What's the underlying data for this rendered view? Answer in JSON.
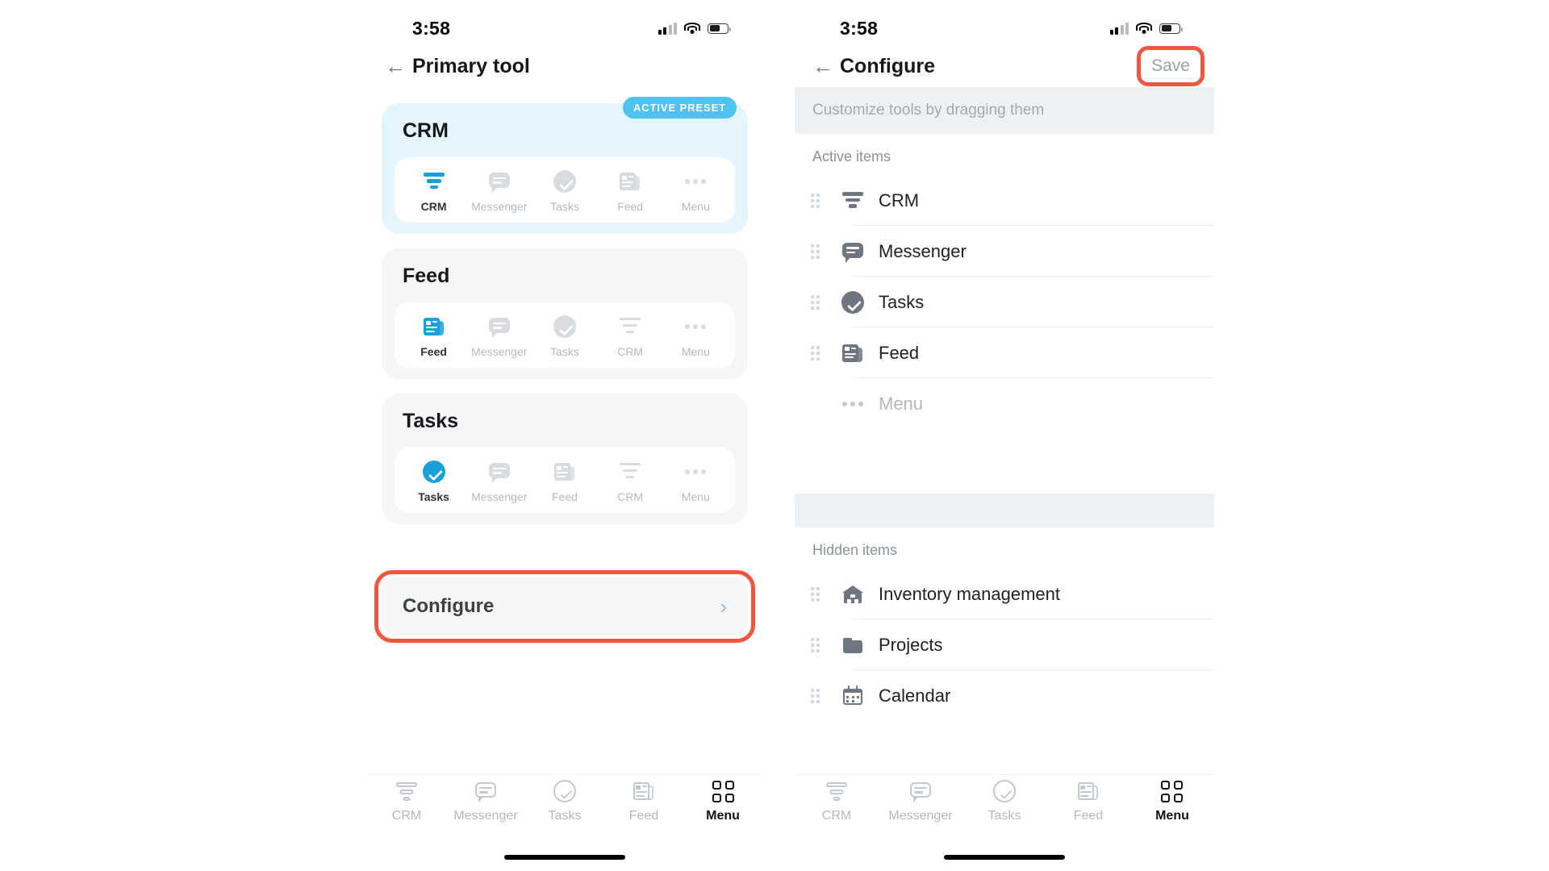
{
  "status_bar": {
    "time": "3:58",
    "icons": {
      "signal": "signal-bars-icon",
      "wifi": "wifi-icon",
      "battery": "battery-icon"
    }
  },
  "left_screen": {
    "nav": {
      "back": "←",
      "title": "Primary tool"
    },
    "presets": [
      {
        "name": "CRM",
        "active": true,
        "badge": "ACTIVE PRESET",
        "tabs": [
          {
            "label": "CRM",
            "icon": "funnel-icon",
            "selected": true
          },
          {
            "label": "Messenger",
            "icon": "chat-icon",
            "selected": false
          },
          {
            "label": "Tasks",
            "icon": "check-icon",
            "selected": false
          },
          {
            "label": "Feed",
            "icon": "news-icon",
            "selected": false
          },
          {
            "label": "Menu",
            "icon": "dots-icon",
            "selected": false
          }
        ]
      },
      {
        "name": "Feed",
        "active": false,
        "badge": "",
        "tabs": [
          {
            "label": "Feed",
            "icon": "news-icon",
            "selected": true
          },
          {
            "label": "Messenger",
            "icon": "chat-icon",
            "selected": false
          },
          {
            "label": "Tasks",
            "icon": "check-icon",
            "selected": false
          },
          {
            "label": "CRM",
            "icon": "funnel-icon",
            "selected": false
          },
          {
            "label": "Menu",
            "icon": "dots-icon",
            "selected": false
          }
        ]
      },
      {
        "name": "Tasks",
        "active": false,
        "badge": "",
        "tabs": [
          {
            "label": "Tasks",
            "icon": "check-icon",
            "selected": true
          },
          {
            "label": "Messenger",
            "icon": "chat-icon",
            "selected": false
          },
          {
            "label": "Feed",
            "icon": "news-icon",
            "selected": false
          },
          {
            "label": "CRM",
            "icon": "funnel-icon",
            "selected": false
          },
          {
            "label": "Menu",
            "icon": "dots-icon",
            "selected": false
          }
        ]
      }
    ],
    "configure": {
      "label": "Configure",
      "chevron": "›",
      "highlighted": true
    }
  },
  "right_screen": {
    "nav": {
      "back": "←",
      "title": "Configure",
      "save": "Save",
      "save_highlighted": true
    },
    "hint": "Customize tools by dragging them",
    "sections": [
      {
        "title": "Active items",
        "items": [
          {
            "label": "CRM",
            "icon": "funnel-icon",
            "draggable": true,
            "muted": false
          },
          {
            "label": "Messenger",
            "icon": "chat-icon",
            "draggable": true,
            "muted": false
          },
          {
            "label": "Tasks",
            "icon": "check-icon",
            "draggable": true,
            "muted": false
          },
          {
            "label": "Feed",
            "icon": "news-icon",
            "draggable": true,
            "muted": false
          },
          {
            "label": "Menu",
            "icon": "dots-icon",
            "draggable": false,
            "muted": true
          }
        ]
      },
      {
        "title": "Hidden items",
        "items": [
          {
            "label": "Inventory management",
            "icon": "warehouse-icon",
            "draggable": true,
            "muted": false
          },
          {
            "label": "Projects",
            "icon": "folder-icon",
            "draggable": true,
            "muted": false
          },
          {
            "label": "Calendar",
            "icon": "calendar-icon",
            "draggable": true,
            "muted": false
          }
        ]
      }
    ]
  },
  "bottom_bar": {
    "items": [
      {
        "label": "CRM",
        "icon": "funnel-icon",
        "active": false
      },
      {
        "label": "Messenger",
        "icon": "chat-icon",
        "active": false
      },
      {
        "label": "Tasks",
        "icon": "check-icon",
        "active": false
      },
      {
        "label": "Feed",
        "icon": "news-icon",
        "active": false
      },
      {
        "label": "Menu",
        "icon": "grid-icon",
        "active": true
      }
    ]
  },
  "colors": {
    "accent_blue": "#199fd9",
    "badge_blue": "#4ec3f0",
    "active_card_bg": "#e4f5fd",
    "card_bg": "#f4f6f8",
    "annotation_red": "#f4553f",
    "muted_text": "#b4b9c0"
  }
}
